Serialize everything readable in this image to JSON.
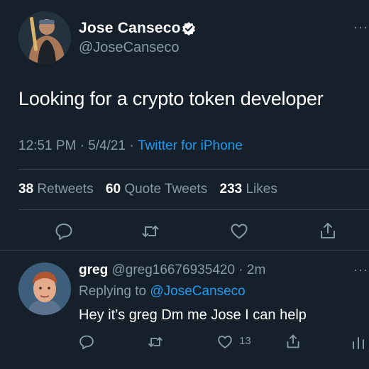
{
  "tweet": {
    "author_name": "Jose Canseco",
    "author_handle": "@JoseCanseco",
    "text": "Looking for a crypto token developer",
    "time": "12:51 PM",
    "date": "5/4/21",
    "source": "Twitter for iPhone",
    "retweets_count": "38",
    "retweets_label": "Retweets",
    "quotes_count": "60",
    "quotes_label": "Quote Tweets",
    "likes_count": "233",
    "likes_label": "Likes",
    "more": "···"
  },
  "reply": {
    "author_name": "greg",
    "author_handle": "@greg16676935420",
    "age": "2m",
    "replying_prefix": "Replying to",
    "replying_to": "@JoseCanseco",
    "text": "Hey it’s greg Dm me Jose I can help",
    "like_count": "13",
    "more": "···"
  },
  "icons": [
    "verified-badge-icon",
    "reply-icon",
    "retweet-icon",
    "like-icon",
    "share-icon",
    "analytics-icon"
  ],
  "colors": {
    "background": "#15202b",
    "muted": "#8899a6",
    "link": "#1d9bf0",
    "divider": "#38444d"
  }
}
